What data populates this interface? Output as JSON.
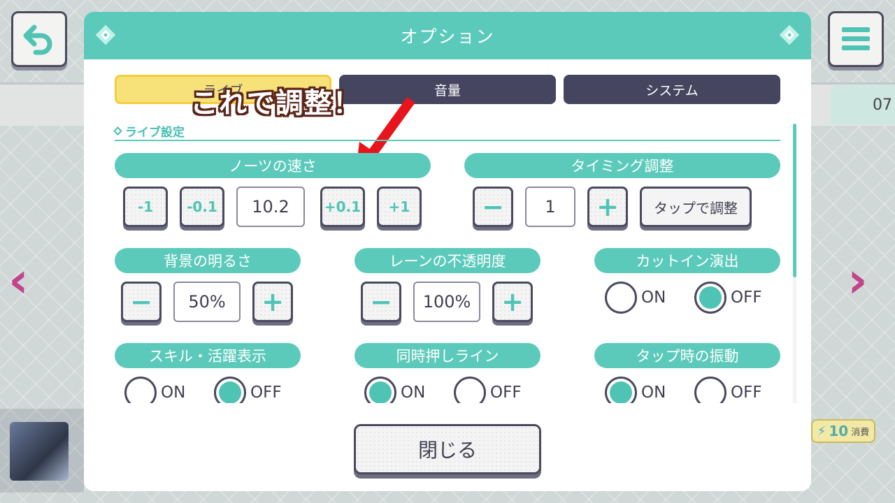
{
  "dialog": {
    "title": "オプション",
    "close_label": "閉じる"
  },
  "tabs": [
    {
      "label": "ライブ",
      "active": true
    },
    {
      "label": "音量",
      "active": false
    },
    {
      "label": "システム",
      "active": false
    }
  ],
  "annotation": "これで調整！",
  "section": {
    "title": "ライブ設定"
  },
  "note_speed": {
    "label": "ノーツの速さ",
    "btn_minus1": "-1",
    "btn_minus01": "-0.1",
    "value": "10.2",
    "btn_plus01": "+0.1",
    "btn_plus1": "+1"
  },
  "timing": {
    "label": "タイミング調整",
    "value": "1",
    "tap_adjust": "タップで調整"
  },
  "bg_brightness": {
    "label": "背景の明るさ",
    "value": "50%"
  },
  "lane_opacity": {
    "label": "レーンの不透明度",
    "value": "100%"
  },
  "cutin": {
    "label": "カットイン演出",
    "on": "ON",
    "off": "OFF",
    "selected": "OFF"
  },
  "skill_display": {
    "label": "スキル・活躍表示",
    "on": "ON",
    "off": "OFF",
    "selected": "OFF"
  },
  "simul_line": {
    "label": "同時押しライン",
    "on": "ON",
    "off": "OFF",
    "selected": "ON"
  },
  "tap_vibration": {
    "label": "タップ時の振動",
    "on": "ON",
    "off": "OFF",
    "selected": "ON"
  },
  "background": {
    "right_number": "07",
    "cost_value": "10",
    "cost_unit": "消費"
  },
  "colors": {
    "accent": "#5ccabb",
    "dark": "#454560",
    "tab_active": "#f7e27a",
    "arrow": "#e8141b",
    "nav_arrow": "#c2448a"
  }
}
